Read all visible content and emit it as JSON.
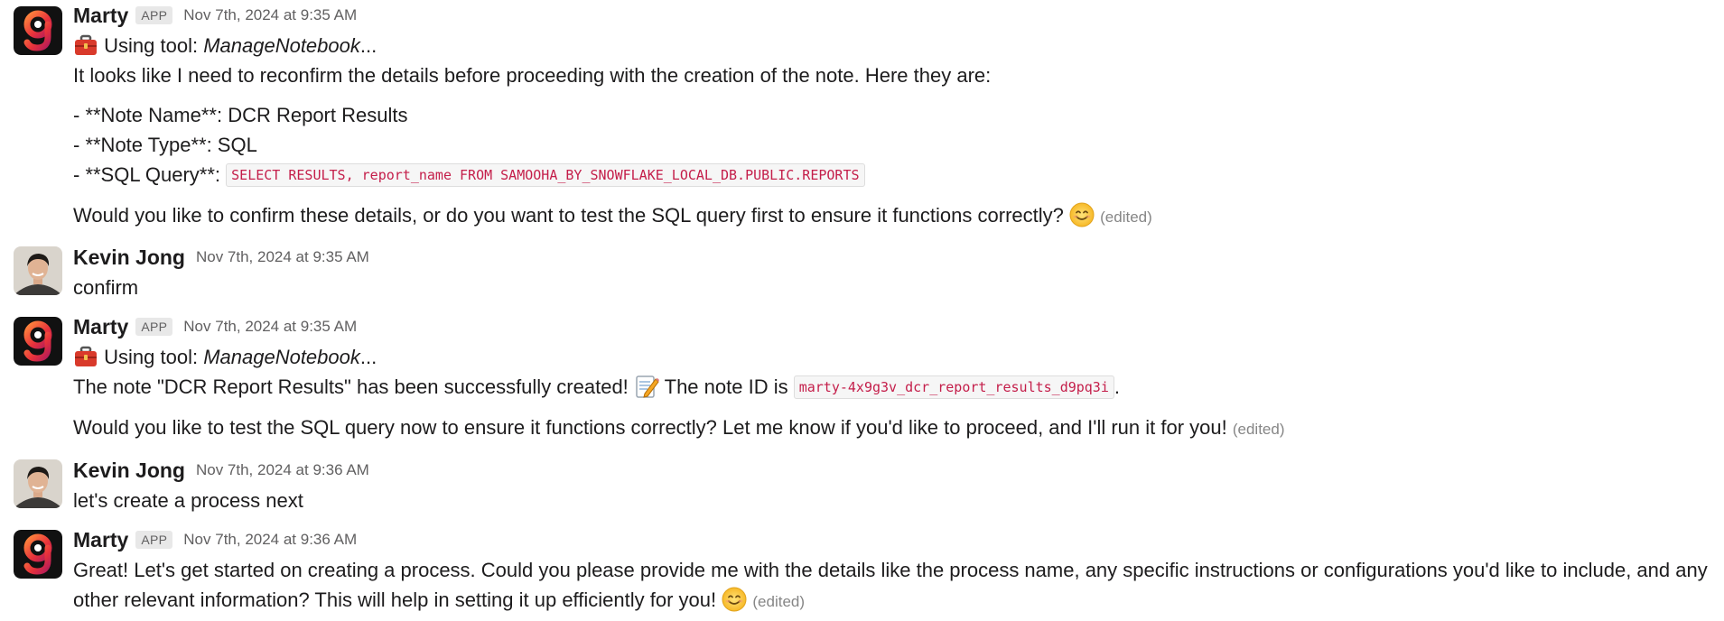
{
  "messages": [
    {
      "author": "Marty",
      "badge": "APP",
      "timestamp": "Nov 7th, 2024 at 9:35 AM",
      "tool_prefix": "Using tool: ",
      "tool_name": "ManageNotebook",
      "tool_suffix": "...",
      "intro": "It looks like I need to reconfirm the details before proceeding with the creation of the note. Here they are:",
      "list": [
        {
          "label": "- **Note Name**: ",
          "value": "DCR Report Results"
        },
        {
          "label": "- **Note Type**: ",
          "value": "SQL"
        },
        {
          "label": "- **SQL Query**: ",
          "code": "SELECT RESULTS, report_name FROM SAMOOHA_BY_SNOWFLAKE_LOCAL_DB.PUBLIC.REPORTS"
        }
      ],
      "question": "Would you like to confirm these details, or do you want to test the SQL query first to ensure it functions correctly?",
      "edited": "(edited)"
    },
    {
      "author": "Kevin Jong",
      "timestamp": "Nov 7th, 2024 at 9:35 AM",
      "text": "confirm"
    },
    {
      "author": "Marty",
      "badge": "APP",
      "timestamp": "Nov 7th, 2024 at 9:35 AM",
      "tool_prefix": "Using tool: ",
      "tool_name": "ManageNotebook",
      "tool_suffix": "...",
      "text_a": "The note \"DCR Report Results\" has been successfully created!",
      "text_b": " The note ID is ",
      "code": "marty-4x9g3v_dcr_report_results_d9pq3i",
      "text_c": ".",
      "followup": "Would you like to test the SQL query now to ensure it functions correctly? Let me know if you'd like to proceed, and I'll run it for you!",
      "edited": "(edited)"
    },
    {
      "author": "Kevin Jong",
      "timestamp": "Nov 7th, 2024 at 9:36 AM",
      "text": "let's create a process next"
    },
    {
      "author": "Marty",
      "badge": "APP",
      "timestamp": "Nov 7th, 2024 at 9:36 AM",
      "text": "Great! Let's get started on creating a process. Could you please provide me with the details like the process name, any specific instructions or configurations you'd like to include, and any other relevant information? This will help in setting it up efficiently for you!",
      "edited": "(edited)"
    }
  ],
  "icons": {
    "bot_avatar": "marty-logo-icon",
    "user_avatar": "user-photo-avatar",
    "tool": "toolbox-icon",
    "smile": "smiling-face-emoji",
    "memo": "memo-emoji"
  },
  "colors": {
    "code_text": "#c41e4a",
    "code_bg": "#f6f6f6",
    "muted": "#616061",
    "logo_bg": "#111111",
    "logo_accent": "#f04e3e"
  }
}
